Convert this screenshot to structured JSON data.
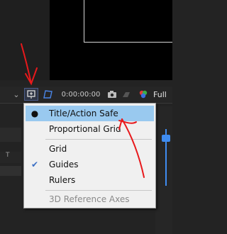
{
  "toolbar": {
    "timecode": "0:00:00:00",
    "resolution_label": "Full",
    "icons": [
      "chevron-down-icon",
      "grid-guide-icon",
      "mask-path-icon",
      "camera-icon",
      "snapshot-icon",
      "color-channel-icon"
    ]
  },
  "menu": {
    "items": [
      {
        "label": "Title/Action Safe",
        "marker": "●",
        "highlighted": true
      },
      {
        "label": "Proportional Grid",
        "marker": ""
      },
      {
        "label": "Grid",
        "marker": ""
      },
      {
        "label": "Guides",
        "marker": "✔"
      },
      {
        "label": "Rulers",
        "marker": ""
      },
      {
        "label": "3D Reference Axes",
        "marker": "",
        "disabled": true
      }
    ]
  },
  "timeline": {
    "row_label": "T"
  },
  "colors": {
    "highlight": "#99c9ef",
    "annotation_red": "#e8191c",
    "cti_blue": "#3f8cf0",
    "menu_bg": "#f0f0f0"
  }
}
